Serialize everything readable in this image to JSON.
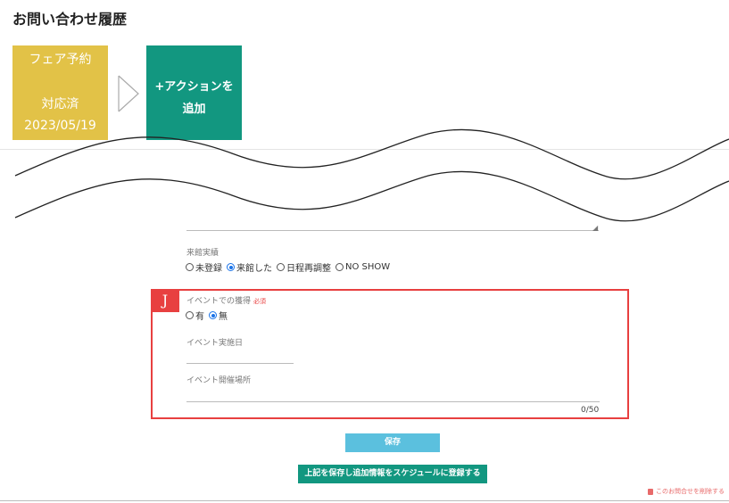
{
  "page": {
    "title": "お問い合わせ履歴"
  },
  "fair_card": {
    "line1": "フェア予約",
    "status": "対応済",
    "date": "2023/05/19",
    "color": "#e2c247"
  },
  "action_card": {
    "line1": "+アクションを",
    "line2": "追加",
    "color": "#129780"
  },
  "visit": {
    "label": "来館実績",
    "options": [
      {
        "label": "未登録",
        "checked": false
      },
      {
        "label": "来館した",
        "checked": true
      },
      {
        "label": "日程再調整",
        "checked": false
      },
      {
        "label": "NO SHOW",
        "checked": false
      }
    ]
  },
  "highlight": {
    "tag": "J",
    "color": "#e84040"
  },
  "event_acquired": {
    "label": "イベントでの獲得",
    "required": "必須",
    "options": [
      {
        "label": "有",
        "checked": false
      },
      {
        "label": "無",
        "checked": true
      }
    ]
  },
  "event_date": {
    "label": "イベント実施日",
    "value": ""
  },
  "event_place": {
    "label": "イベント開催場所",
    "value": "",
    "counter": "0/50"
  },
  "buttons": {
    "save": "保存",
    "save_schedule": "上記を保存し追加情報をスケジュールに登録する"
  },
  "delete_link": "このお問合せを削除する",
  "icons": {
    "arrow": "chevron-right-outline-icon",
    "trash": "trash-icon",
    "radio": "radio-icon"
  }
}
